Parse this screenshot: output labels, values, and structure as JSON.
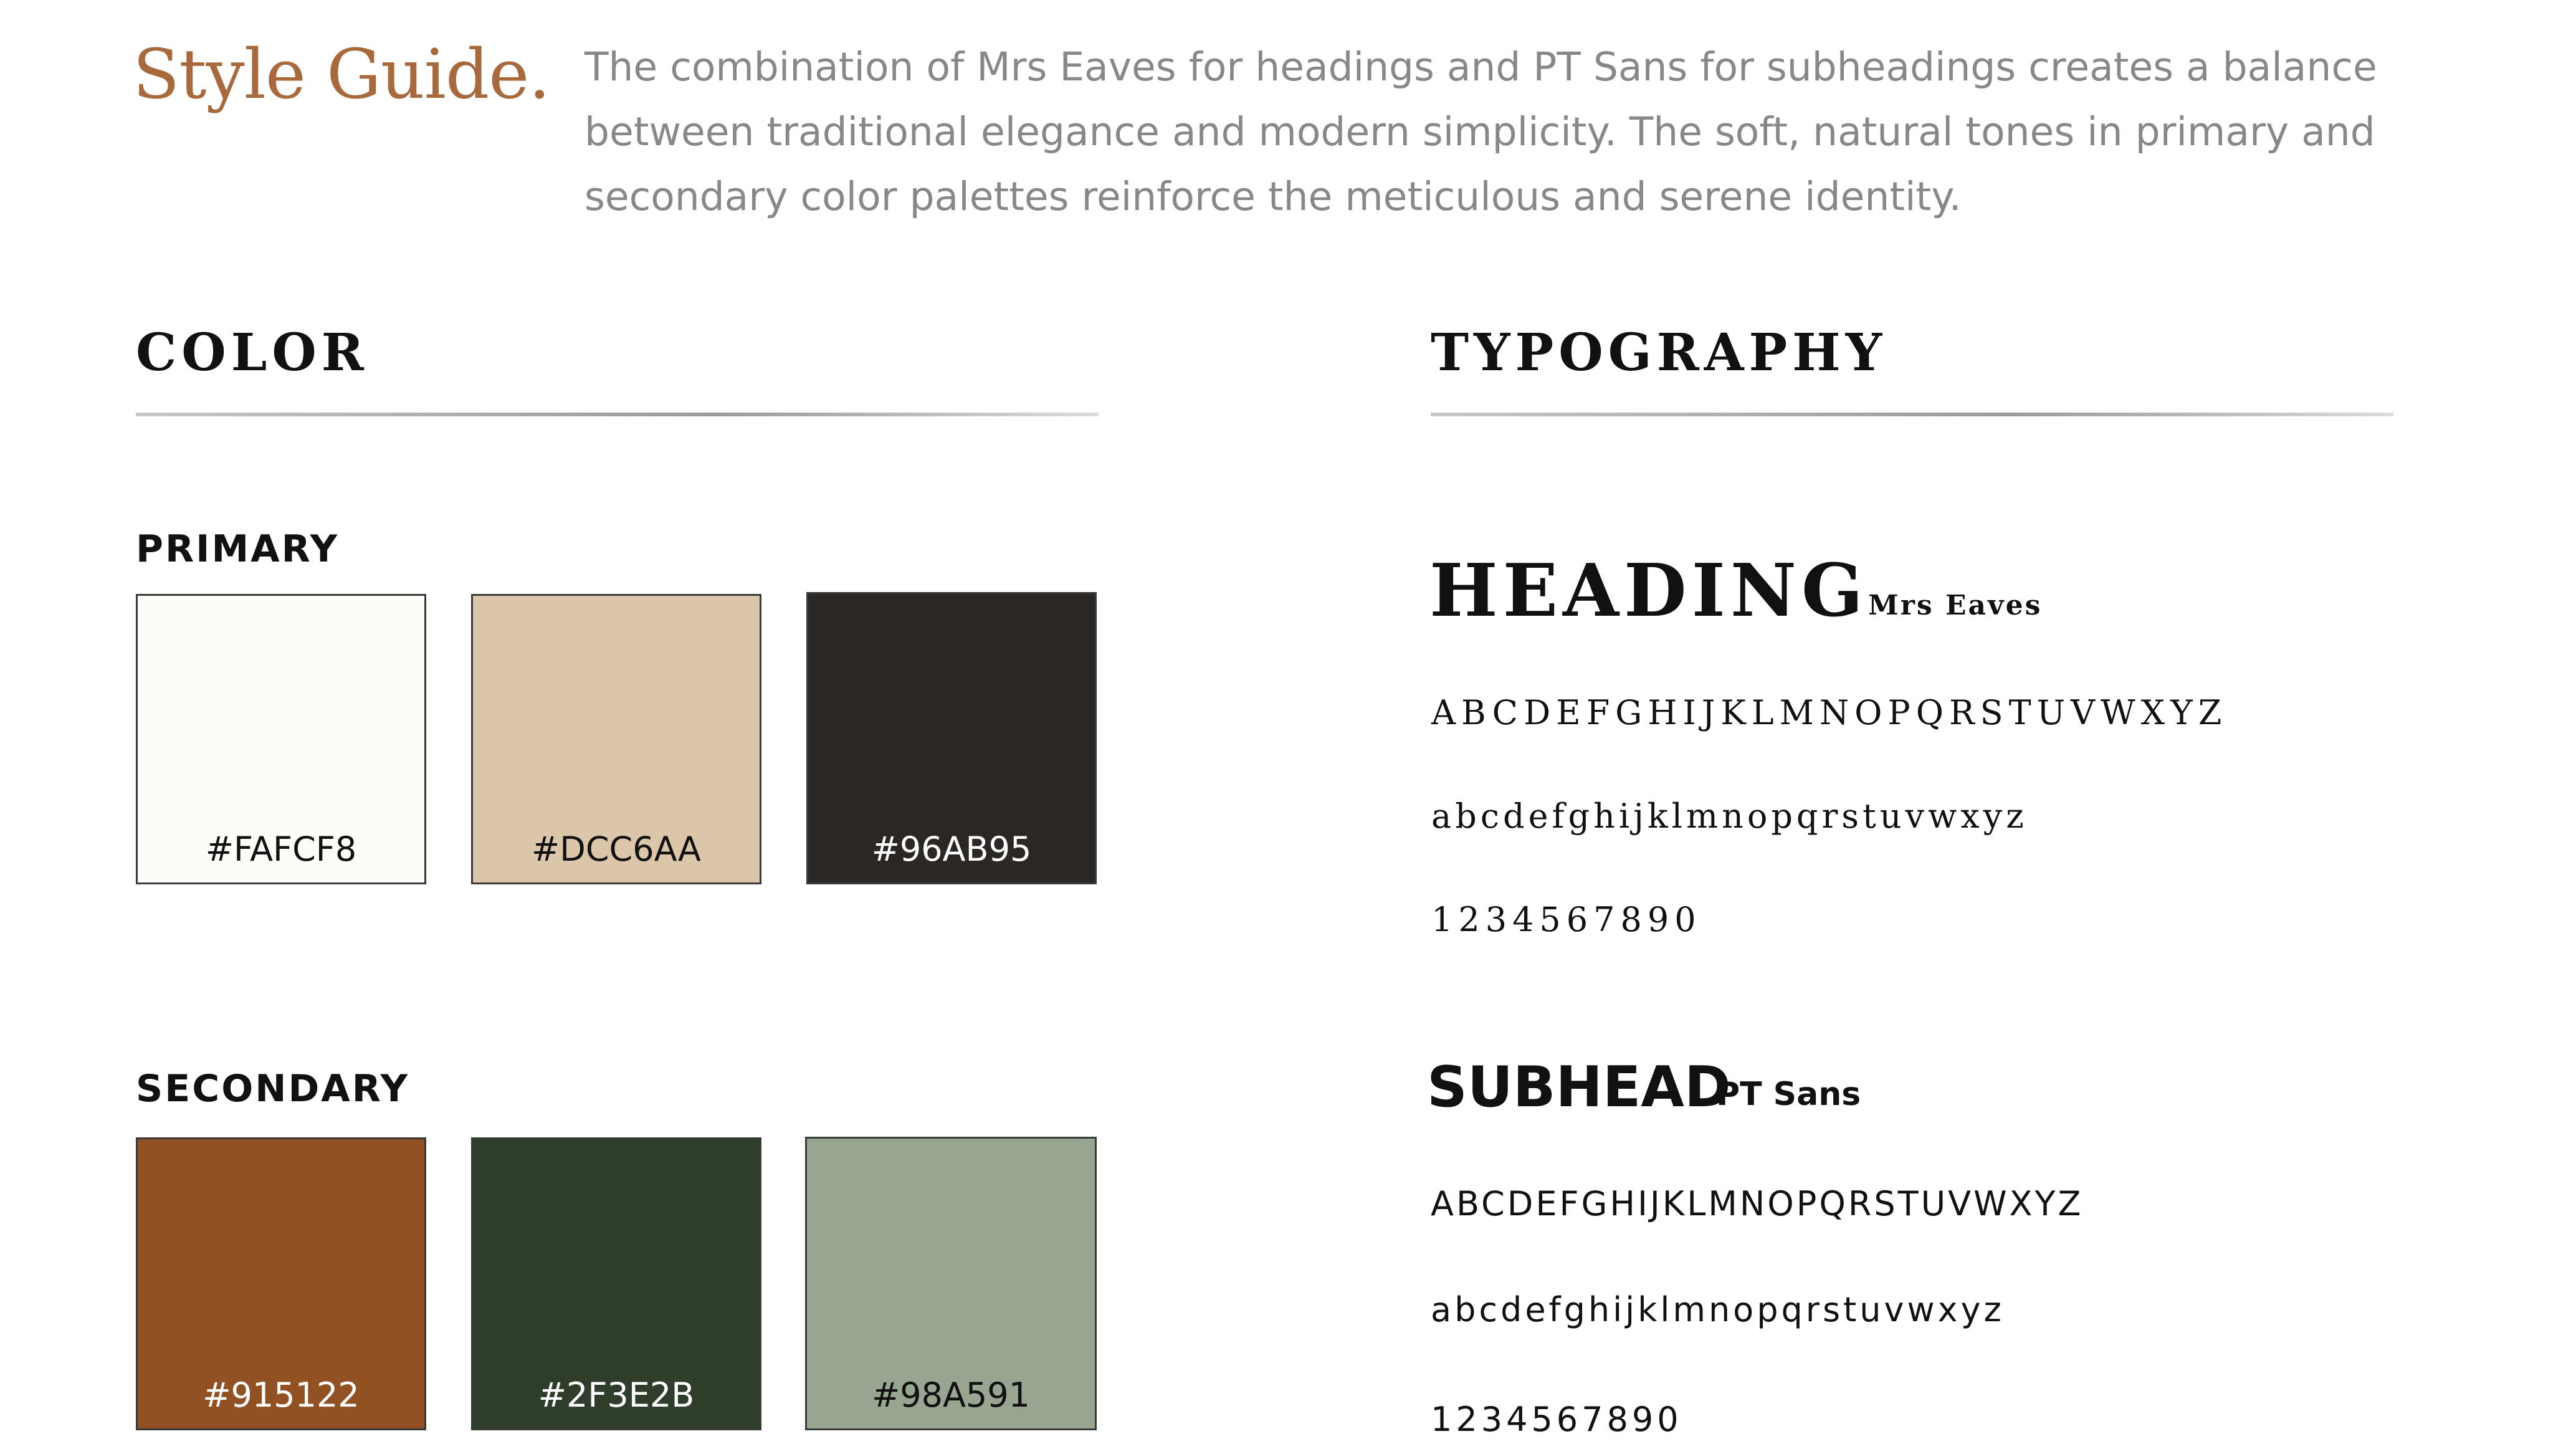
{
  "header": {
    "title": "Style Guide.",
    "intro": "The combination of Mrs Eaves for headings and PT Sans for subheadings creates a balance between traditional elegance and modern simplicity. The soft, natural tones in primary and secondary color palettes reinforce the meticulous and serene identity."
  },
  "color": {
    "title": "COLOR",
    "primary": {
      "label": "PRIMARY",
      "swatches": [
        {
          "hex": "#FAFCF8",
          "fill": "#FCFCF9",
          "text_color": "#111111"
        },
        {
          "hex": "#DCC6AA",
          "fill": "#DCC6AA",
          "text_color": "#111111"
        },
        {
          "hex": "#96AB95",
          "fill": "#2A2725",
          "text_color": "#FFFFFF"
        }
      ]
    },
    "secondary": {
      "label": "SECONDARY",
      "swatches": [
        {
          "hex": "#915122",
          "fill": "#915122",
          "text_color": "#FFFFFF"
        },
        {
          "hex": "#2F3E2B",
          "fill": "#2F3E2B",
          "text_color": "#FFFFFF"
        },
        {
          "hex": "#98A591",
          "fill": "#98A591",
          "text_color": "#111111"
        }
      ]
    }
  },
  "typography": {
    "title": "TYPOGRAPHY",
    "heading": {
      "label": "HEADING",
      "font_name": "Mrs Eaves",
      "uppercase": "ABCDEFGHIJKLMNOPQRSTUVWXYZ",
      "lowercase": "abcdefghijklmnopqrstuvwxyz",
      "numerals": "1234567890"
    },
    "subhead": {
      "label": "SUBHEAD",
      "font_name": "PT Sans",
      "uppercase": "ABCDEFGHIJKLMNOPQRSTUVWXYZ",
      "lowercase": "abcdefghijklmnopqrstuvwxyz",
      "numerals": "1234567890"
    }
  },
  "colors": {
    "title_accent": "#A86A3C",
    "intro_text": "#888888",
    "rule": "#9A9A9A"
  }
}
